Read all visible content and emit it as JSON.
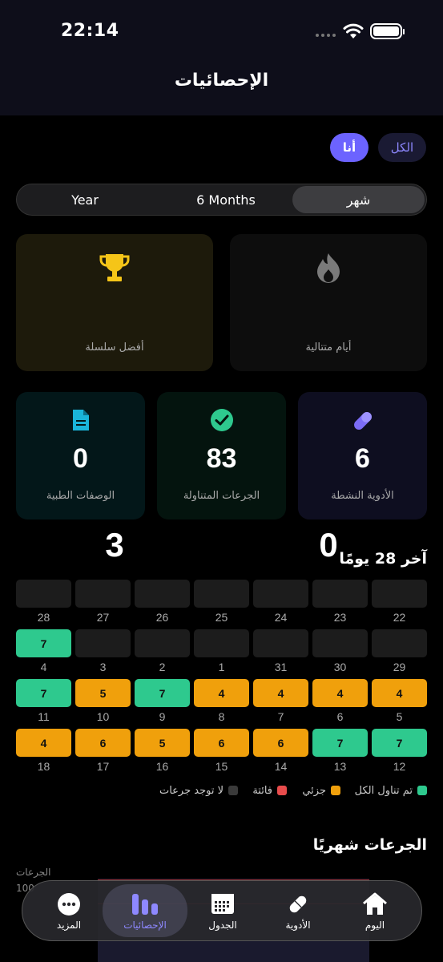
{
  "status": {
    "time": "22:14"
  },
  "header": {
    "title": "الإحصائيات"
  },
  "scope": {
    "all": "الكل",
    "me": "أنا"
  },
  "period": {
    "year": "Year",
    "six_months": "6 Months",
    "month": "شهر"
  },
  "stats": {
    "best_streak": {
      "value": "3",
      "label": "أفضل سلسلة",
      "icon": "trophy-icon",
      "color": "#f5c518"
    },
    "consecutive_days": {
      "value": "0",
      "label": "أيام متتالية",
      "icon": "flame-icon",
      "color": "#888888"
    },
    "prescriptions": {
      "value": "0",
      "label": "الوصفات الطبية",
      "icon": "document-icon",
      "color": "#1ab4d9"
    },
    "doses_taken": {
      "value": "83",
      "label": "الجرعات المتناولة",
      "icon": "check-circle-icon",
      "color": "#2ec98e"
    },
    "active_meds": {
      "value": "6",
      "label": "الأدوية النشطة",
      "icon": "pill-icon",
      "color": "#7b6cf6"
    }
  },
  "last28": {
    "title": "آخر 28 يومًا",
    "colors": {
      "all": "#2ec98e",
      "partial": "#f0a00c",
      "missed": "#e84c4c",
      "none": "#1c1c1c"
    },
    "rows": [
      [
        {
          "day": "28",
          "status": "none",
          "count": ""
        },
        {
          "day": "27",
          "status": "none",
          "count": ""
        },
        {
          "day": "26",
          "status": "none",
          "count": ""
        },
        {
          "day": "25",
          "status": "none",
          "count": ""
        },
        {
          "day": "24",
          "status": "none",
          "count": ""
        },
        {
          "day": "23",
          "status": "none",
          "count": ""
        },
        {
          "day": "22",
          "status": "none",
          "count": ""
        }
      ],
      [
        {
          "day": "4",
          "status": "all",
          "count": "7"
        },
        {
          "day": "3",
          "status": "none",
          "count": ""
        },
        {
          "day": "2",
          "status": "none",
          "count": ""
        },
        {
          "day": "1",
          "status": "none",
          "count": ""
        },
        {
          "day": "31",
          "status": "none",
          "count": ""
        },
        {
          "day": "30",
          "status": "none",
          "count": ""
        },
        {
          "day": "29",
          "status": "none",
          "count": ""
        }
      ],
      [
        {
          "day": "11",
          "status": "all",
          "count": "7"
        },
        {
          "day": "10",
          "status": "partial",
          "count": "5"
        },
        {
          "day": "9",
          "status": "all",
          "count": "7"
        },
        {
          "day": "8",
          "status": "partial",
          "count": "4"
        },
        {
          "day": "7",
          "status": "partial",
          "count": "4"
        },
        {
          "day": "6",
          "status": "partial",
          "count": "4"
        },
        {
          "day": "5",
          "status": "partial",
          "count": "4"
        }
      ],
      [
        {
          "day": "18",
          "status": "partial",
          "count": "4"
        },
        {
          "day": "17",
          "status": "partial",
          "count": "6"
        },
        {
          "day": "16",
          "status": "partial",
          "count": "5"
        },
        {
          "day": "15",
          "status": "partial",
          "count": "6"
        },
        {
          "day": "14",
          "status": "partial",
          "count": "6"
        },
        {
          "day": "13",
          "status": "all",
          "count": "7"
        },
        {
          "day": "12",
          "status": "all",
          "count": "7"
        }
      ]
    ],
    "legend": {
      "all": "تم تناول الكل",
      "partial": "جزئي",
      "missed": "فائتة",
      "none": "لا توجد جرعات"
    }
  },
  "monthly": {
    "title": "الجرعات شهريًا",
    "y_label": "الجرعات",
    "y_tick": "100"
  },
  "tabbar": {
    "today": "اليوم",
    "meds": "الأدوية",
    "schedule": "الجدول",
    "stats": "الإحصائيات",
    "more": "المزيد",
    "active": "stats",
    "active_color": "#8e88ff"
  }
}
